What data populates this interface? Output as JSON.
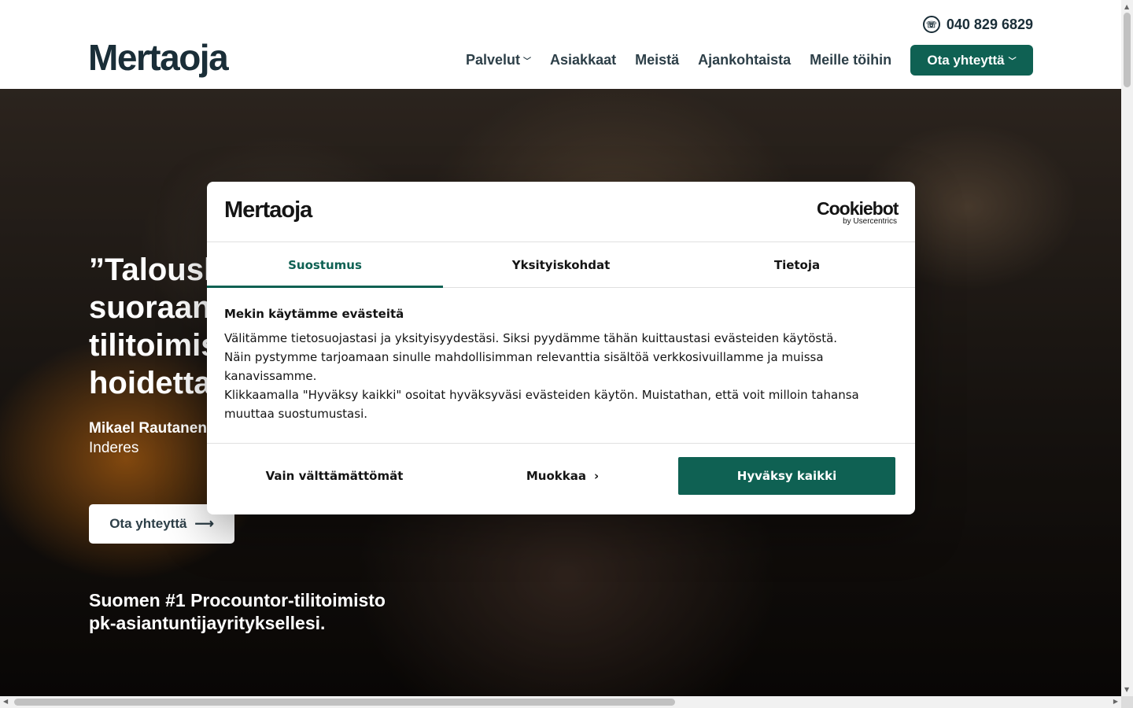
{
  "header": {
    "logo": "Mertaoja",
    "phone": "040 829 6829",
    "nav": [
      {
        "label": "Palvelut",
        "has_dropdown": true
      },
      {
        "label": "Asiakkaat"
      },
      {
        "label": "Meistä"
      },
      {
        "label": "Ajankohtaista"
      },
      {
        "label": "Meille töihin"
      }
    ],
    "cta_label": "Ota yhteyttä"
  },
  "hero": {
    "quote": "”Taloush\nsuoraan\ntilitoimis\nhoidetta",
    "author": "Mikael Rautanen",
    "company": "Inderes",
    "cta_label": "Ota yhteyttä",
    "subheading_line1": "Suomen #1 Procountor-tilitoimisto",
    "subheading_line2": "pk-asiantuntijayrityksellesi."
  },
  "cookie_dialog": {
    "logo": "Mertaoja",
    "provider_name": "Cookiebot",
    "provider_by": "by Usercentrics",
    "tabs": [
      {
        "label": "Suostumus",
        "active": true
      },
      {
        "label": "Yksityiskohdat",
        "active": false
      },
      {
        "label": "Tietoja",
        "active": false
      }
    ],
    "heading": "Mekin käytämme evästeitä",
    "body": "Välitämme tietosuojastasi ja yksityisyydestäsi. Siksi pyydämme tähän kuittaustasi evästeiden käytöstä.\nNäin pystymme tarjoamaan sinulle mahdollisimman relevanttia sisältöä verkkosivuillamme ja muissa kanavissamme.\nKlikkaamalla \"Hyväksy kaikki\" osoitat hyväksyväsi evästeiden käytön. Muistathan, että voit milloin tahansa muuttaa suostumustasi.",
    "buttons": {
      "necessary": "Vain välttämättömät",
      "customize": "Muokkaa",
      "accept_all": "Hyväksy kaikki"
    }
  },
  "colors": {
    "brand_green": "#0f6153",
    "text_dark": "#1a2e38"
  }
}
